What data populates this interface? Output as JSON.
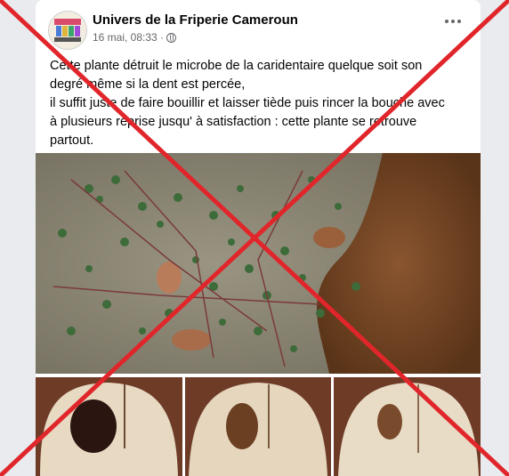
{
  "post": {
    "page_name": "Univers de la Friperie Cameroun",
    "timestamp": "16 mai, 08:33 ·",
    "privacy_icon": "globe-icon",
    "text_lines": [
      "Cette plante détruit le microbe de la caridentaire quelque soit son",
      "degré même si la dent est percée,",
      "il suffit juste de faire bouillir et laisser tiède puis rincer la bouche avec",
      "à plusieurs reprise jusqu' à satisfaction : cette plante se retrouve",
      "partout."
    ]
  },
  "overlay": {
    "type": "red-x",
    "color": "#e0262b"
  },
  "colors": {
    "text": "#050505",
    "secondary": "#65676b",
    "background": "#e9ebee"
  }
}
